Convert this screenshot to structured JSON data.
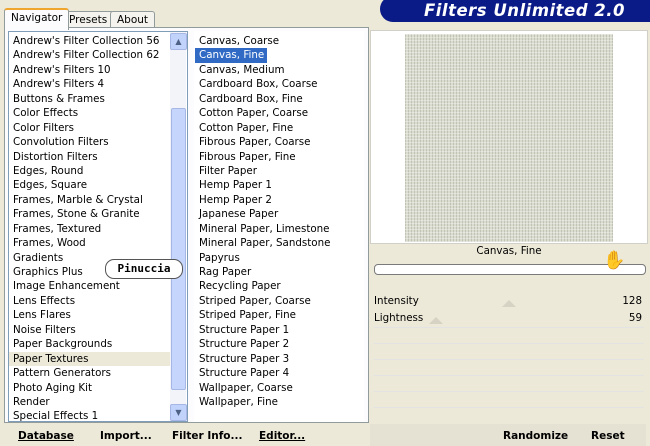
{
  "tabs": [
    {
      "label": "Navigator",
      "active": true
    },
    {
      "label": "Presets",
      "active": false
    },
    {
      "label": "About",
      "active": false
    }
  ],
  "banner": {
    "title": "Filters Unlimited 2.0"
  },
  "categories": {
    "items": [
      "Andrew's Filter Collection 56",
      "Andrew's Filter Collection 62",
      "Andrew's Filters 10",
      "Andrew's Filters 4",
      "Buttons & Frames",
      "Color Effects",
      "Color Filters",
      "Convolution Filters",
      "Distortion Filters",
      "Edges, Round",
      "Edges, Square",
      "Frames, Marble & Crystal",
      "Frames, Stone & Granite",
      "Frames, Textured",
      "Frames, Wood",
      "Gradients",
      "Graphics Plus",
      "Image Enhancement",
      "Lens Effects",
      "Lens Flares",
      "Noise Filters",
      "Paper Backgrounds",
      "Paper Textures",
      "Pattern Generators",
      "Photo Aging Kit",
      "Render",
      "Special Effects 1"
    ],
    "highlighted_index": 22
  },
  "watermark": "Pinuccia",
  "filters": {
    "items": [
      "Canvas, Coarse",
      "Canvas, Fine",
      "Canvas, Medium",
      "Cardboard Box, Coarse",
      "Cardboard Box, Fine",
      "Cotton Paper, Coarse",
      "Cotton Paper, Fine",
      "Fibrous Paper, Coarse",
      "Fibrous Paper, Fine",
      "Filter Paper",
      "Hemp Paper 1",
      "Hemp Paper 2",
      "Japanese Paper",
      "Mineral Paper, Limestone",
      "Mineral Paper, Sandstone",
      "Papyrus",
      "Rag Paper",
      "Recycling Paper",
      "Striped Paper, Coarse",
      "Striped Paper, Fine",
      "Structure Paper 1",
      "Structure Paper 2",
      "Structure Paper 3",
      "Structure Paper 4",
      "Wallpaper, Coarse",
      "Wallpaper, Fine"
    ],
    "selected_index": 1
  },
  "preview": {
    "filter_name": "Canvas, Fine"
  },
  "sliders": [
    {
      "label": "Intensity",
      "value": "128",
      "level": 0.5
    },
    {
      "label": "Lightness",
      "value": "59",
      "level": 0.23
    }
  ],
  "buttons": {
    "database": "Database",
    "import": "Import...",
    "filter_info": "Filter Info...",
    "editor": "Editor...",
    "randomize": "Randomize",
    "reset": "Reset"
  },
  "colors": {
    "banner": "#0a1a86",
    "selection": "#316ac5",
    "window": "#ece9d8"
  }
}
